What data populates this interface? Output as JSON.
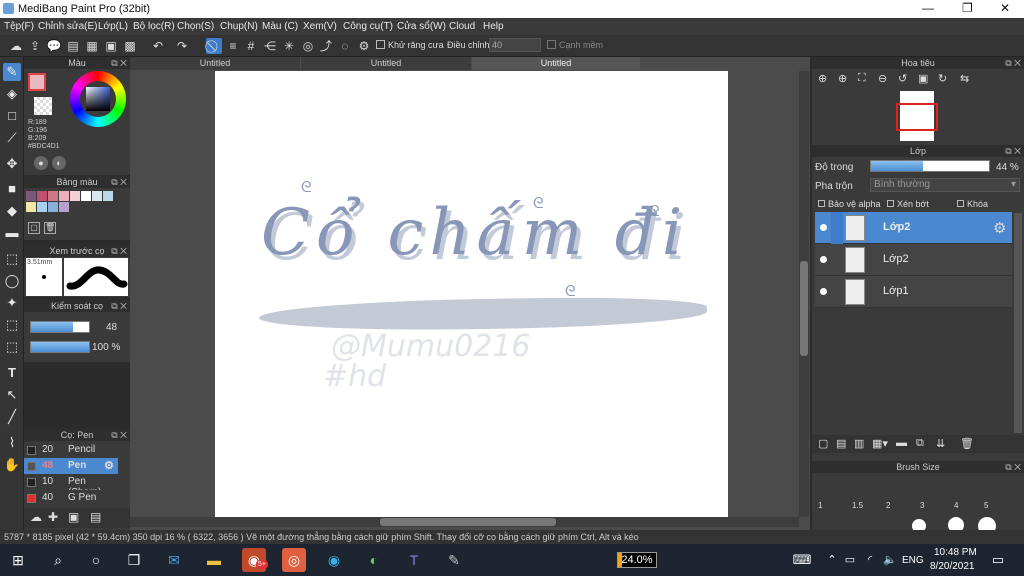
{
  "window": {
    "title": "MediBang Paint Pro (32bit)",
    "min": "—",
    "max": "❐",
    "close": "✕"
  },
  "menu": [
    "Tệp(F)",
    "Chỉnh sửa(E)",
    "Lớp(L)",
    "Bộ lọc(R)",
    "Chọn(S)",
    "Chụp(N)",
    "Màu (C)",
    "Xem(V)",
    "Công cụ(T)",
    "Cửa sổ(W)",
    "Cloud",
    "Help"
  ],
  "toolbar": {
    "antialias_label": "Khử răng cưa",
    "adjust_label": "Điều chỉnh",
    "adjust_value": "40",
    "smooth_label": "Cạnh mềm"
  },
  "color_panel": {
    "title": "Màu",
    "r": "R:189",
    "g": "G:196",
    "b": "B:209",
    "hex": "#BDC4D1",
    "fg": "#BDC4D1"
  },
  "palette_panel": {
    "title": "Bảng màu",
    "swatches": [
      "#7a5a78",
      "#c05070",
      "#d07888",
      "#eab0bc",
      "#f3d0d6",
      "#fff",
      "#d8e6f0",
      "#b6d8ea",
      "#f0e6a8",
      "#a8d0f0",
      "#88b0d8",
      "#b8a0d0"
    ]
  },
  "brush_preview": {
    "title": "Xem trước cọ",
    "size": "3.51mm"
  },
  "brush_control": {
    "title": "Kiểm soát cọ",
    "size_value": "48",
    "opacity_value": "100 %"
  },
  "brush_list": {
    "title": "Cọ: Pen",
    "items": [
      {
        "size": "20",
        "name": "Pencil",
        "color": "#222"
      },
      {
        "size": "48",
        "name": "Pen",
        "color": "#555"
      },
      {
        "size": "10",
        "name": "Pen (Sharp)",
        "color": "#222"
      },
      {
        "size": "40",
        "name": "G Pen",
        "color": "#e03030"
      }
    ]
  },
  "tabs": [
    "Untitled",
    "Untitled",
    "Untitled"
  ],
  "canvas": {
    "title_text": "Cổ chấm đi",
    "signature": "@Mumu0216",
    "tag": "#hd"
  },
  "navigator": {
    "title": "Hoa tiêu"
  },
  "layer_panel": {
    "title": "Lớp",
    "opacity_label": "Độ trong",
    "opacity_value": "44 %",
    "opacity_fraction": 0.44,
    "blend_label": "Pha trộn",
    "blend_value": "Bình thường",
    "protect_alpha": "Bảo vệ alpha",
    "clipping": "Xén bớt",
    "lock": "Khóa",
    "layers": [
      "Lớp2",
      "Lớp2",
      "Lớp1"
    ]
  },
  "brush_size_panel": {
    "title": "Brush Size",
    "sizes": [
      "1",
      "1.5",
      "2",
      "3",
      "4",
      "5"
    ]
  },
  "status": "5787 * 8185 pixel   (42 * 59.4cm)   350 dpi   16 %   ( 6322, 3656 )   Vẽ một đường thẳng bằng cách giữ phím Shift. Thay đổi cỡ cọ bằng cách giữ phím Ctrl, Alt và kéo",
  "taskbar": {
    "badge": "5+",
    "zoom_box": "24.0%",
    "lang": "ENG",
    "time": "10:48 PM",
    "date": "8/20/2021"
  }
}
